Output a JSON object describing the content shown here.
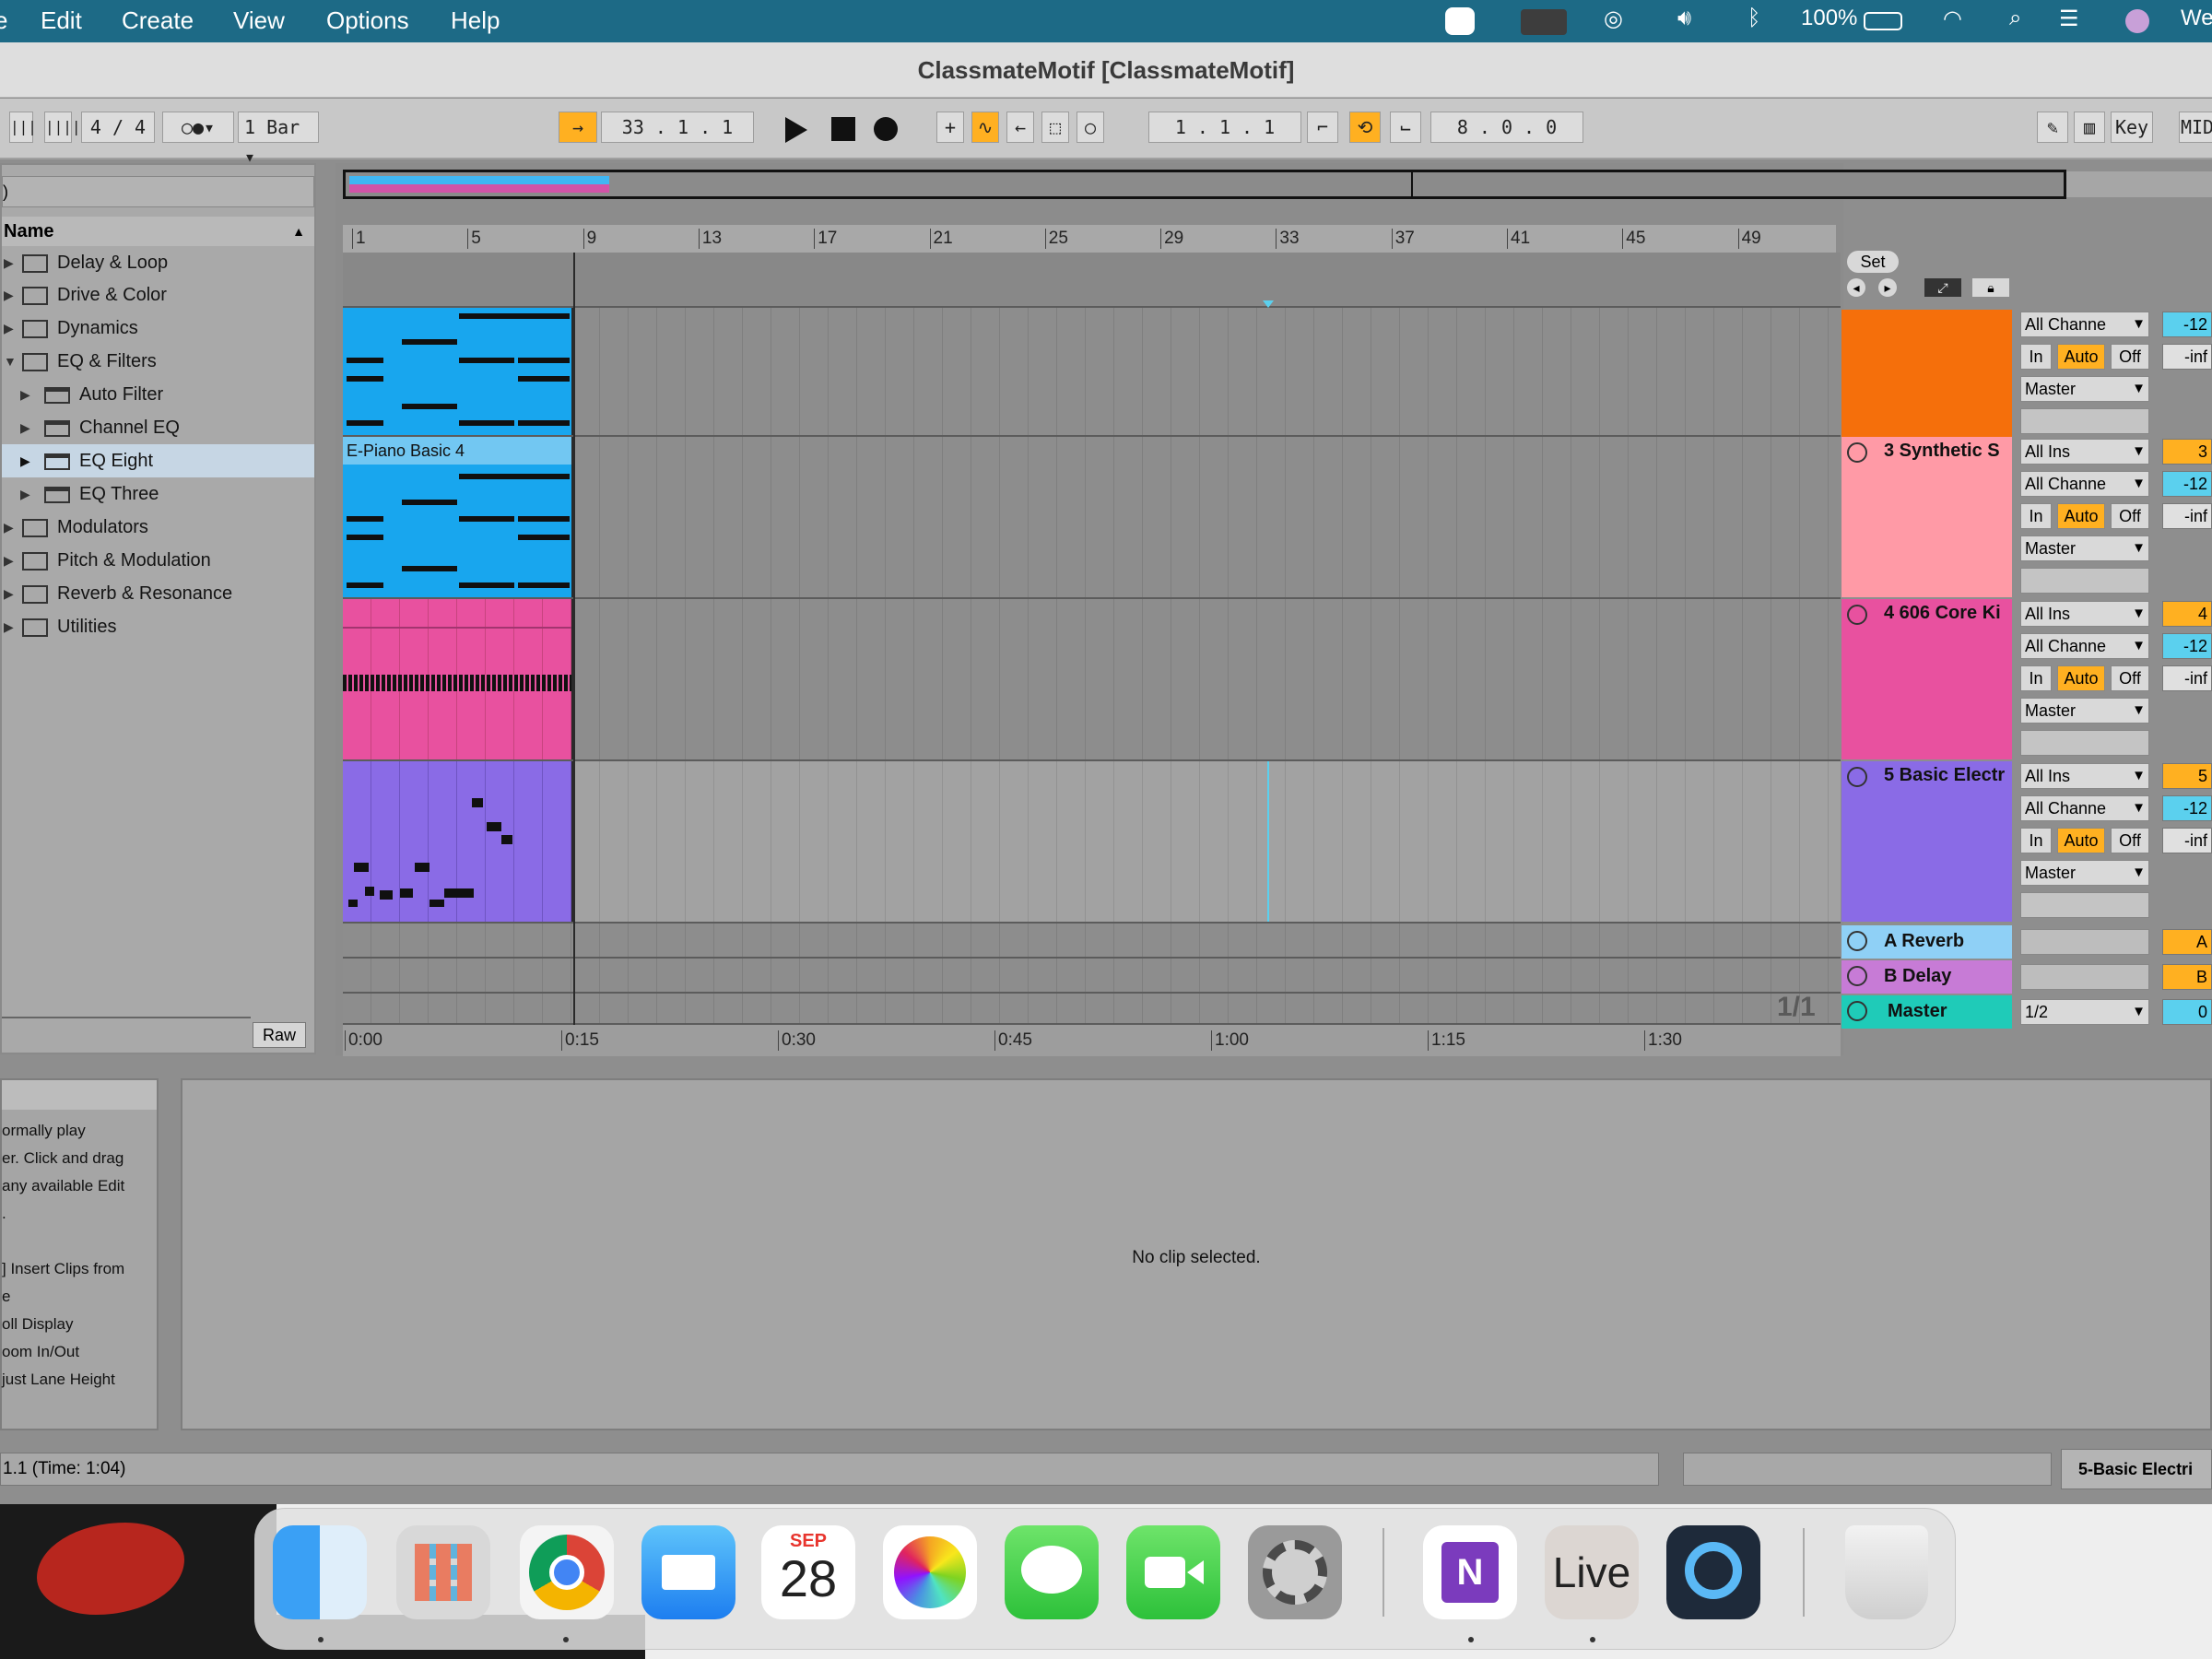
{
  "menubar": {
    "items": [
      "Edit",
      "Create",
      "View",
      "Options",
      "Help"
    ],
    "battery": "100%",
    "clock_partial": "We"
  },
  "window": {
    "title": "ClassmateMotif  [ClassmateMotif]"
  },
  "controls": {
    "time_sig": "4 / 4",
    "quantize": "1 Bar",
    "position": "33 .  1 .  1",
    "loop_start": "1 .  1 .  1",
    "loop_length": "8 .  0 .  0",
    "key_label": "Key",
    "midi_label": "MID"
  },
  "browser": {
    "header": "Name",
    "items": [
      {
        "label": "Delay & Loop",
        "type": "folder"
      },
      {
        "label": "Drive & Color",
        "type": "folder"
      },
      {
        "label": "Dynamics",
        "type": "folder"
      },
      {
        "label": "EQ & Filters",
        "type": "folder"
      },
      {
        "label": "Auto Filter",
        "type": "device"
      },
      {
        "label": "Channel EQ",
        "type": "device"
      },
      {
        "label": "EQ Eight",
        "type": "device",
        "selected": true
      },
      {
        "label": "EQ Three",
        "type": "device"
      },
      {
        "label": "Modulators",
        "type": "folder"
      },
      {
        "label": "Pitch & Modulation",
        "type": "folder"
      },
      {
        "label": "Reverb & Resonance",
        "type": "folder"
      },
      {
        "label": "Utilities",
        "type": "folder"
      }
    ],
    "raw_label": "Raw"
  },
  "ruler": {
    "bars": [
      "1",
      "5",
      "9",
      "13",
      "17",
      "21",
      "25",
      "29",
      "33",
      "37",
      "41",
      "45",
      "49"
    ],
    "times": [
      "0:00",
      "0:15",
      "0:30",
      "0:45",
      "1:00",
      "1:15",
      "1:30"
    ],
    "page": "1/1"
  },
  "set_label": "Set",
  "clips": {
    "epiano": "E-Piano Basic 4"
  },
  "tracks": [
    {
      "name": "",
      "color": "#f56f0b",
      "input": "",
      "channel": "All Channe",
      "monitor": [
        "In",
        "Auto",
        "Off"
      ],
      "output": "Master",
      "vol": "-12",
      "pan": "-inf",
      "num": ""
    },
    {
      "name": "3 Synthetic S",
      "color": "#ff9aa6",
      "input": "All Ins",
      "channel": "All Channe",
      "monitor": [
        "In",
        "Auto",
        "Off"
      ],
      "output": "Master",
      "vol": "-12",
      "pan": "-inf",
      "num": "3"
    },
    {
      "name": "4 606 Core Ki",
      "color": "#e8519f",
      "input": "All Ins",
      "channel": "All Channe",
      "monitor": [
        "In",
        "Auto",
        "Off"
      ],
      "output": "Master",
      "vol": "-12",
      "pan": "-inf",
      "num": "4"
    },
    {
      "name": "5 Basic Electr",
      "color": "#8a6be6",
      "input": "All Ins",
      "channel": "All Channe",
      "monitor": [
        "In",
        "Auto",
        "Off"
      ],
      "output": "Master",
      "vol": "-12",
      "pan": "-inf",
      "num": "5"
    }
  ],
  "returns": [
    {
      "name": "A Reverb",
      "color": "#8fd0f6",
      "tag": "A"
    },
    {
      "name": "B Delay",
      "color": "#c77bd6",
      "tag": "B"
    },
    {
      "name": "Master",
      "color": "#1fcbb8",
      "tag": "0",
      "output": "1/2"
    }
  ],
  "info": {
    "lines": [
      "ormally play",
      "er. Click and drag",
      " any available Edit",
      ".",
      "",
      "] Insert Clips from",
      "e",
      "oll Display",
      "oom In/Out",
      "just Lane Height"
    ]
  },
  "detail": {
    "empty": "No clip selected."
  },
  "status": {
    "left": "1.1 (Time: 1:04)",
    "right": "5-Basic Electri"
  },
  "dock": {
    "calendar_month": "SEP",
    "calendar_day": "28",
    "live_label": "Live"
  }
}
